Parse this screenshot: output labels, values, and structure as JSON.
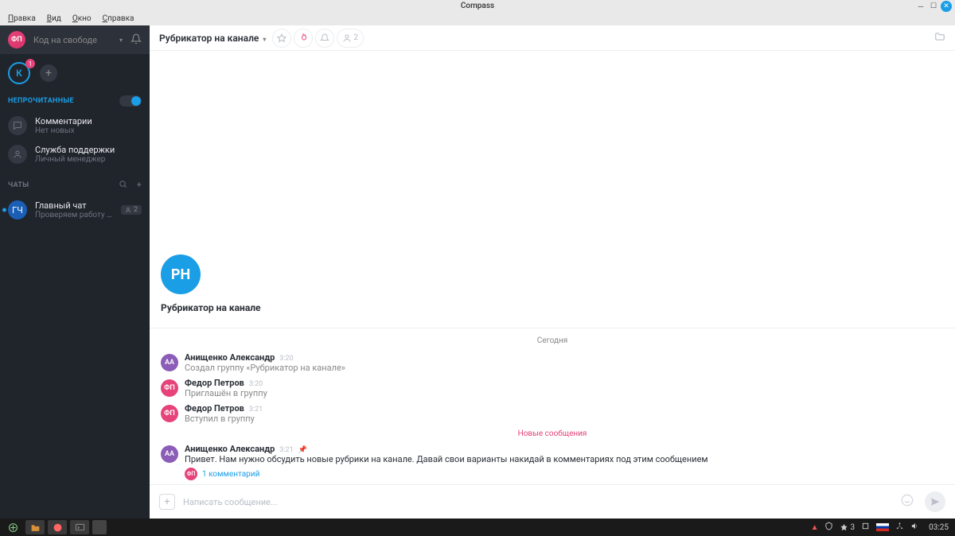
{
  "window": {
    "title": "Compass"
  },
  "menubar": [
    {
      "label": "Правка",
      "u": 0
    },
    {
      "label": "Вид",
      "u": 0
    },
    {
      "label": "Окно",
      "u": 0
    },
    {
      "label": "Справка",
      "u": 0
    }
  ],
  "sidebar": {
    "user_initials": "ФП",
    "status": "Код на свободе",
    "workspace_initial": "К",
    "workspace_badge": "1",
    "section_unread": "НЕПРОЧИТАННЫЕ",
    "section_chats": "ЧАТЫ",
    "items_unread": [
      {
        "title": "Комментарии",
        "subtitle": "Нет новых",
        "icon": "comment"
      },
      {
        "title": "Служба поддержки",
        "subtitle": "Личный менеджер",
        "icon": "support"
      }
    ],
    "items_chats": [
      {
        "title": "Главный чат",
        "subtitle": "Проверяем работу фу...",
        "initials": "ГЧ",
        "selected": true,
        "members": "2"
      }
    ]
  },
  "chat": {
    "title": "Рубрикатор на канале",
    "member_count": "2",
    "intro_initials": "РН",
    "intro_title": "Рубрикатор на канале",
    "date_label": "Сегодня",
    "new_label": "Новые сообщения",
    "messages": [
      {
        "av": "АА",
        "av_cls": "av-aa",
        "name": "Анищенко Александр",
        "time": "3:20",
        "text": "Создал группу «Рубрикатор на канале»",
        "system": true
      },
      {
        "av": "ФП",
        "av_cls": "av-fp",
        "name": "Федор Петров",
        "time": "3:20",
        "text": "Приглашён в группу",
        "system": true
      },
      {
        "av": "ФП",
        "av_cls": "av-fp",
        "name": "Федор Петров",
        "time": "3:21",
        "text": "Вступил в группу",
        "system": true
      }
    ],
    "new_messages": [
      {
        "av": "АА",
        "av_cls": "av-aa",
        "name": "Анищенко Александр",
        "time": "3:21",
        "pinned": true,
        "text": "Привет. Нам нужно обсудить новые рубрики на канале. Давай свои варианты накидай в комментариях под этим сообщением",
        "thread": {
          "av": "ФП",
          "label": "1 комментарий"
        }
      }
    ],
    "composer_placeholder": "Написать сообщение..."
  },
  "taskbar": {
    "notif_count": "3",
    "clock": "03:25"
  }
}
